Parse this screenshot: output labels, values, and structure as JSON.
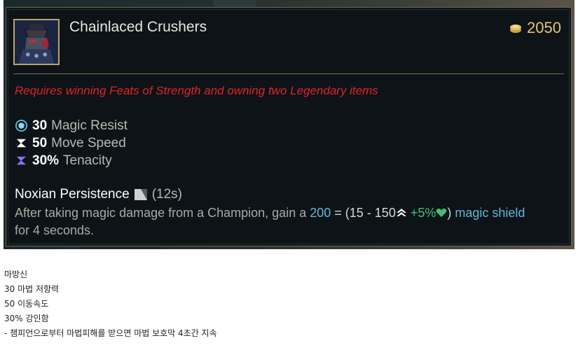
{
  "item": {
    "name": "Chainlaced Crushers",
    "cost": "2050",
    "requirement": "Requires winning Feats of Strength and owning two Legendary items",
    "icon": "chainlaced-crushers-item-icon"
  },
  "stats": [
    {
      "value": "30",
      "label": "Magic Resist",
      "icon": "magic-resist-icon"
    },
    {
      "value": "50",
      "label": "Move Speed",
      "icon": "move-speed-icon"
    },
    {
      "value": "30%",
      "label": "Tenacity",
      "icon": "tenacity-icon"
    }
  ],
  "passive": {
    "name": "Noxian Persistence",
    "cooldown": "(12s)",
    "desc_1": "After taking magic damage from a Champion, gain a ",
    "shield_value": "200",
    "formula_open": " = (15 - 150",
    "scaling": " +5%",
    "formula_close": ")",
    "shield_label": " magic shield",
    "desc_2": "for 4 seconds."
  },
  "colors": {
    "requirement": "#e0222a",
    "gold": "#e9c36b",
    "shield": "#5fb7d6",
    "health_scaling": "#3fc276"
  },
  "notes": [
    "마방신",
    "30 마법 저항력",
    "50 이동속도",
    "30% 강인함",
    "- 챔피언으로부터 마법피해를 받으면 마법 보호막 4초간 지속"
  ]
}
